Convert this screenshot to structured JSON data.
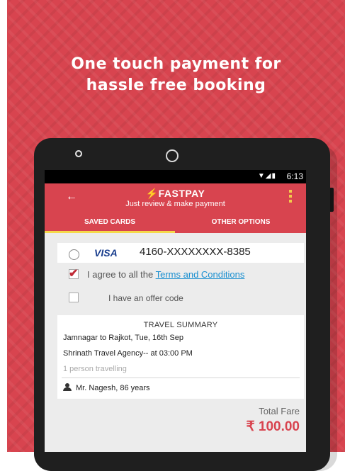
{
  "promo": {
    "headline_line1": "One touch payment for",
    "headline_line2": "hassle free booking",
    "background_color": "#d8444f"
  },
  "statusbar": {
    "time": "6:13",
    "icons": [
      "wifi-icon",
      "signal-icon",
      "battery-icon"
    ]
  },
  "appbar": {
    "title": "⚡FASTPAY",
    "subtitle": "Just review & make payment",
    "back_icon": "back-arrow-icon",
    "menu_icon": "overflow-menu-icon"
  },
  "tabs": [
    {
      "label": "SAVED CARDS",
      "active": true
    },
    {
      "label": "OTHER OPTIONS",
      "active": false
    }
  ],
  "saved_card": {
    "brand": "VISA",
    "number": "4160-XXXXXXXX-8385",
    "selected": false
  },
  "agree": {
    "checked": true,
    "prefix": "I agree to all the ",
    "link": "Terms and Conditions"
  },
  "offer": {
    "checked": false,
    "label": "I have an offer code"
  },
  "summary": {
    "title": "TRAVEL SUMMARY",
    "route": "Jamnagar to Rajkot, Tue, 16th  Sep",
    "agency": "Shrinath Travel Agency-- at 03:00 PM",
    "travellers": "1 person travelling",
    "passenger": "Mr. Nagesh, 86 years"
  },
  "fare": {
    "label": "Total Fare",
    "value": "₹ 100.00"
  }
}
